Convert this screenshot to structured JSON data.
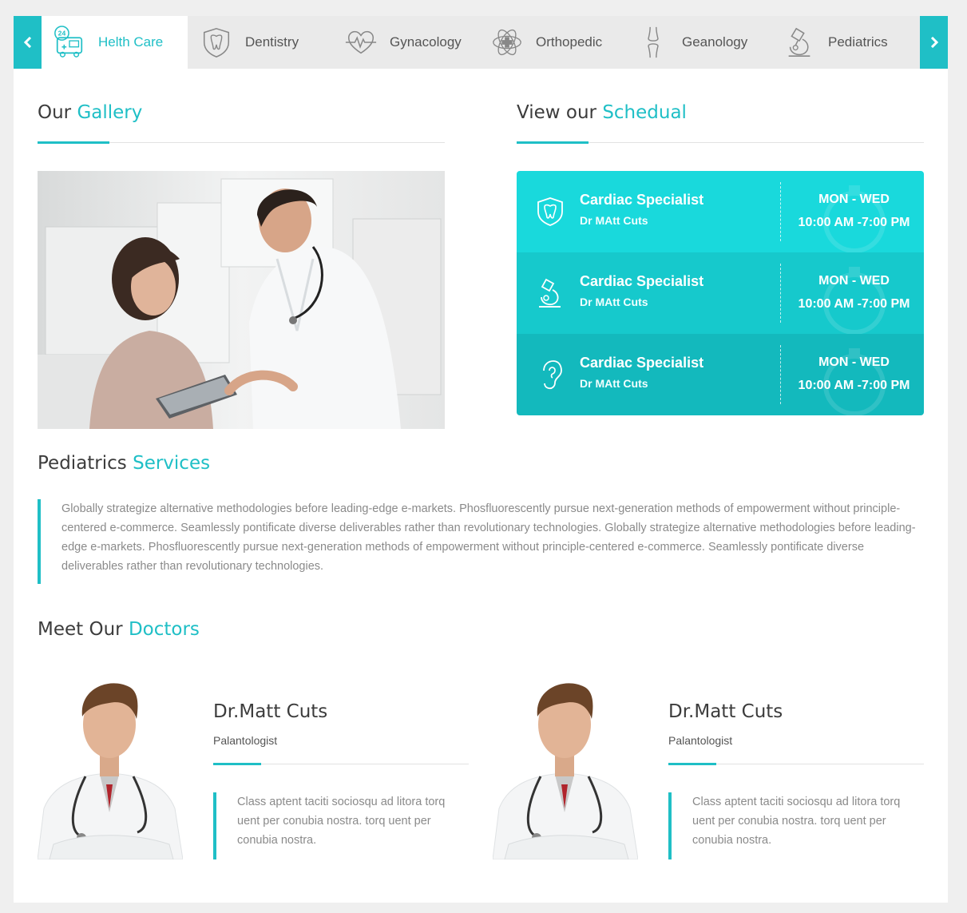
{
  "tabs": {
    "prev_icon": "chevron-left-icon",
    "next_icon": "chevron-right-icon",
    "items": [
      {
        "label": "Helth Care",
        "icon": "24hrs-ambulance-icon",
        "active": true
      },
      {
        "label": "Dentistry",
        "icon": "tooth-icon"
      },
      {
        "label": "Gynacology",
        "icon": "heartbeat-icon"
      },
      {
        "label": "Orthopedic",
        "icon": "medical-cross-atom-icon"
      },
      {
        "label": "Geanology",
        "icon": "bone-joint-icon"
      },
      {
        "label": "Pediatrics",
        "icon": "microscope-icon"
      }
    ]
  },
  "gallery": {
    "heading_plain": "Our",
    "heading_highlight": "Gallery",
    "image": "doctor-with-patient-photo"
  },
  "schedule": {
    "heading_plain": "View our",
    "heading_highlight": "Schedual",
    "rows": [
      {
        "title": "Cardiac Specialist",
        "doctor": "Dr MAtt Cuts",
        "days": "MON - WED",
        "time": "10:00 AM -7:00 PM",
        "icon": "tooth-shield-icon",
        "color": "#19d9dc"
      },
      {
        "title": "Cardiac Specialist",
        "doctor": "Dr MAtt Cuts",
        "days": "MON - WED",
        "time": "10:00 AM -7:00 PM",
        "icon": "microscope-icon",
        "color": "#16c9cc"
      },
      {
        "title": "Cardiac Specialist",
        "doctor": "Dr MAtt Cuts",
        "days": "MON - WED",
        "time": "10:00 AM -7:00 PM",
        "icon": "ear-icon",
        "color": "#13b9bd"
      }
    ]
  },
  "services": {
    "heading_plain": "Pediatrics",
    "heading_highlight": "Services",
    "text": "Globally strategize alternative methodologies before leading-edge e-markets. Phosfluorescently pursue next-generation methods of empowerment without principle-centered e-commerce. Seamlessly pontificate diverse deliverables rather than revolutionary technologies. Globally strategize alternative methodologies before leading-edge e-markets. Phosfluorescently pursue next-generation methods of empowerment without principle-centered e-commerce. Seamlessly pontificate diverse deliverables rather than revolutionary technologies."
  },
  "doctors": {
    "heading_plain": "Meet Our",
    "heading_highlight": "Doctors",
    "items": [
      {
        "name": "Dr.Matt Cuts",
        "role": "Palantologist",
        "bio": "Class aptent taciti sociosqu ad litora torq uent per conubia nostra. torq uent per conubia nostra."
      },
      {
        "name": "Dr.Matt Cuts",
        "role": "Palantologist",
        "bio": "Class aptent taciti sociosqu ad litora torq uent per conubia nostra. torq uent per conubia nostra."
      }
    ]
  },
  "colors": {
    "accent": "#1fbfc6",
    "text": "#3c3c3c",
    "muted": "#8a8a8a"
  }
}
